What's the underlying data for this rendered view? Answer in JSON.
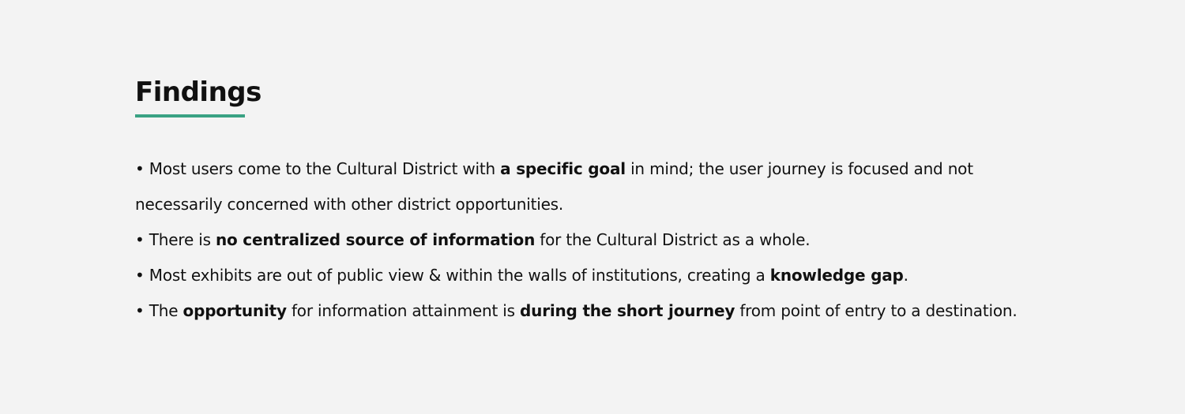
{
  "heading": "Findings",
  "accent_color": "#3aa283",
  "bullet": "• ",
  "findings": [
    {
      "segments": [
        {
          "text": "Most users come to the Cultural District with ",
          "bold": false
        },
        {
          "text": "a specific goal",
          "bold": true
        },
        {
          "text": " in mind; the user journey is focused and not necessarily concerned with other district opportunities.",
          "bold": false
        }
      ]
    },
    {
      "segments": [
        {
          "text": "There is ",
          "bold": false
        },
        {
          "text": "no centralized source of information",
          "bold": true
        },
        {
          "text": " for the Cultural District as a whole.",
          "bold": false
        }
      ]
    },
    {
      "segments": [
        {
          "text": "Most exhibits are out of public view & within the walls of institutions, creating a ",
          "bold": false
        },
        {
          "text": "knowledge gap",
          "bold": true
        },
        {
          "text": ".",
          "bold": false
        }
      ]
    },
    {
      "segments": [
        {
          "text": "The ",
          "bold": false
        },
        {
          "text": "opportunity",
          "bold": true
        },
        {
          "text": " for information attainment is ",
          "bold": false
        },
        {
          "text": "during the short journey",
          "bold": true
        },
        {
          "text": " from point of entry to a destination.",
          "bold": false
        }
      ]
    }
  ]
}
